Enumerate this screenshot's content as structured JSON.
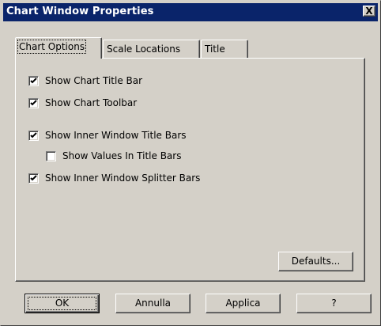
{
  "window": {
    "title": "Chart Window Properties",
    "close_label": "X"
  },
  "tabs": [
    {
      "label": "Chart Options",
      "active": true
    },
    {
      "label": "Scale Locations",
      "active": false
    },
    {
      "label": "Title",
      "active": false
    }
  ],
  "options": [
    {
      "label": "Show Chart Title Bar",
      "checked": true
    },
    {
      "label": "Show Chart Toolbar",
      "checked": true
    },
    {
      "label": "Show Inner Window Title Bars",
      "checked": true
    },
    {
      "label": "Show Values In Title Bars",
      "checked": false
    },
    {
      "label": "Show Inner Window Splitter Bars",
      "checked": true
    }
  ],
  "panel": {
    "defaults_label": "Defaults..."
  },
  "footer": {
    "ok_label": "OK",
    "cancel_label": "Annulla",
    "apply_label": "Applica",
    "help_label": "?"
  }
}
